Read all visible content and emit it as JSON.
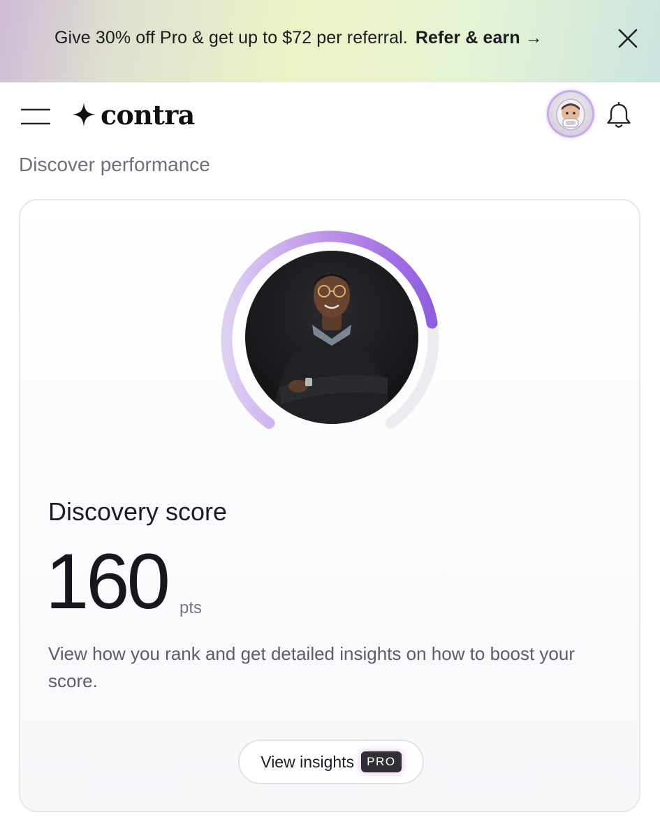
{
  "banner": {
    "text": "Give 30% off Pro & get up to $72 per referral.",
    "link_label": "Refer & earn →"
  },
  "header": {
    "logo_text": "contra"
  },
  "page": {
    "section_title": "Discover performance"
  },
  "discovery": {
    "score_label": "Discovery score",
    "score_value": "160",
    "score_unit": "pts",
    "description": "View how you rank and get detailed insights on how to boost your score.",
    "gauge_progress": 0.78,
    "button_label": "View insights",
    "badge": "PRO"
  },
  "colors": {
    "gauge_start": "#d9c8f0",
    "gauge_end": "#8f5fe0",
    "accent_glow": "#c8a9e8"
  }
}
